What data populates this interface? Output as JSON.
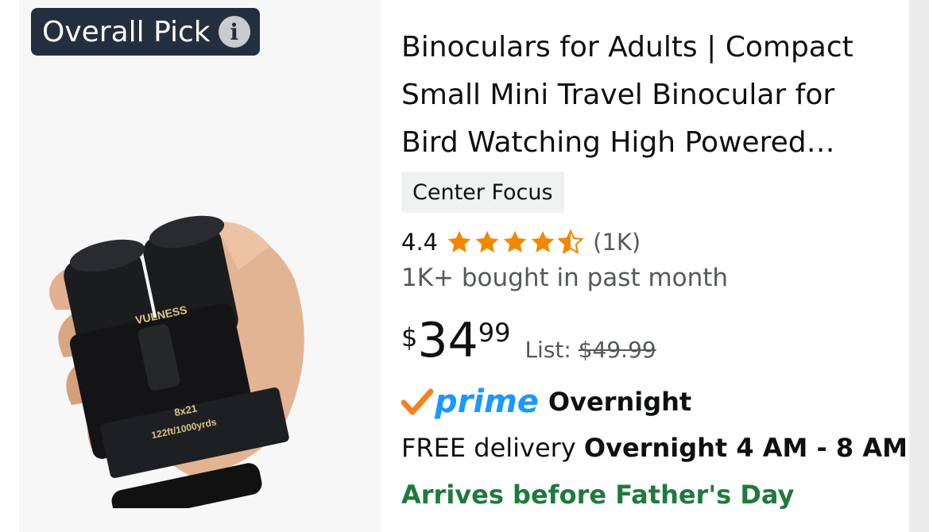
{
  "badge": {
    "label": "Overall Pick",
    "info_icon": "info-icon"
  },
  "product": {
    "title": "Binoculars for Adults | Compact Small Mini Travel Binocular for Bird Watching High Powered…",
    "variant": "Center Focus",
    "rating": "4.4",
    "rating_value": 4.4,
    "rating_max": 5,
    "review_count": "(1K)",
    "bought": "1K+ bought in past month",
    "price": {
      "symbol": "$",
      "whole": "34",
      "fraction": "99"
    },
    "list_label": "List:",
    "list_price": "$49.99",
    "prime": {
      "label": "prime",
      "speed": "Overnight"
    },
    "delivery_prefix": "FREE delivery ",
    "delivery_window": "Overnight 4 AM - 8 AM",
    "arrives": "Arrives before Father's Day",
    "image_text": {
      "brand": "VULNESS",
      "spec": "8x21",
      "range": "122ft/1000yrds"
    }
  },
  "colors": {
    "star": "#f08804",
    "prime_blue": "#1a98ff",
    "check_orange": "#f5821f",
    "arrives_green": "#1f7a3d",
    "badge_bg": "#232f3e"
  }
}
